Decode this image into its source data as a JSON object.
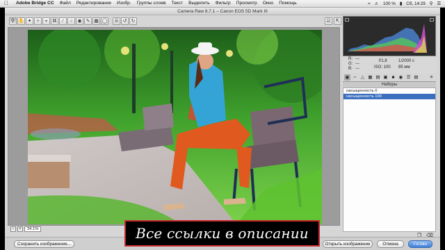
{
  "menubar": {
    "app": "Adobe Bridge CC",
    "items": [
      "Файл",
      "Редактирование",
      "Изобр.",
      "Группы слоев",
      "Текст",
      "Выделить",
      "Фильтр",
      "Просмотр",
      "Окно",
      "Помощь"
    ],
    "battery": "100 %",
    "clock": "Сб, 14:29"
  },
  "window": {
    "title": "Camera Raw 8.7.1  –  Canon EOS 5D Mark III"
  },
  "camera_info": {
    "r_label": "R:",
    "g_label": "G:",
    "b_label": "B:",
    "r_val": "---",
    "g_val": "---",
    "b_val": "---",
    "aperture": "f/1,8",
    "shutter": "1/2000 с",
    "iso": "ISO: 100",
    "focal": "85 мм"
  },
  "presets": {
    "header": "Наборы",
    "items": [
      {
        "label": "насыщенность 0",
        "selected": false
      },
      {
        "label": "насыщенность 100",
        "selected": true
      }
    ]
  },
  "preview": {
    "zoom": "34.1%"
  },
  "buttons": {
    "save": "Сохранить изображение...",
    "open": "Открыть изображение",
    "cancel": "Отмена",
    "done": "Готово"
  },
  "caption": {
    "text": "Все ссылки в описании"
  },
  "colors": {
    "accent": "#3d7fd8",
    "selection": "#3c6fbf",
    "caption_border": "#c7282c"
  }
}
